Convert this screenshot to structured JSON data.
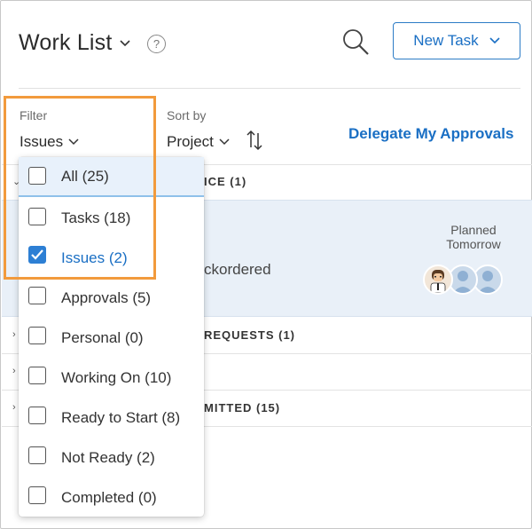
{
  "header": {
    "title": "Work List",
    "help": "?",
    "new_task_label": "New Task"
  },
  "toolbar": {
    "filter_label": "Filter",
    "filter_value": "Issues",
    "sort_label": "Sort by",
    "sort_value": "Project",
    "delegate_label": "Delegate My Approvals"
  },
  "list": {
    "groups": [
      {
        "label": "ICE (1)"
      },
      {
        "label": "REQUESTS (1)"
      },
      {
        "label": "MITTED (15)"
      }
    ],
    "task": {
      "text": "ckordered",
      "planned_label": "Planned",
      "planned_value": "Tomorrow"
    }
  },
  "filter_menu": {
    "items": [
      {
        "label": "All (25)",
        "checked": false
      },
      {
        "label": "Tasks (18)",
        "checked": false
      },
      {
        "label": "Issues (2)",
        "checked": true
      },
      {
        "label": "Approvals (5)",
        "checked": false
      },
      {
        "label": "Personal (0)",
        "checked": false
      },
      {
        "label": "Working On (10)",
        "checked": false
      },
      {
        "label": "Ready to Start (8)",
        "checked": false
      },
      {
        "label": "Not Ready (2)",
        "checked": false
      },
      {
        "label": "Completed (0)",
        "checked": false
      }
    ]
  },
  "colors": {
    "accent": "#1a6fc4",
    "highlight": "#f29a3c",
    "selected_row": "#e9f0f8"
  }
}
